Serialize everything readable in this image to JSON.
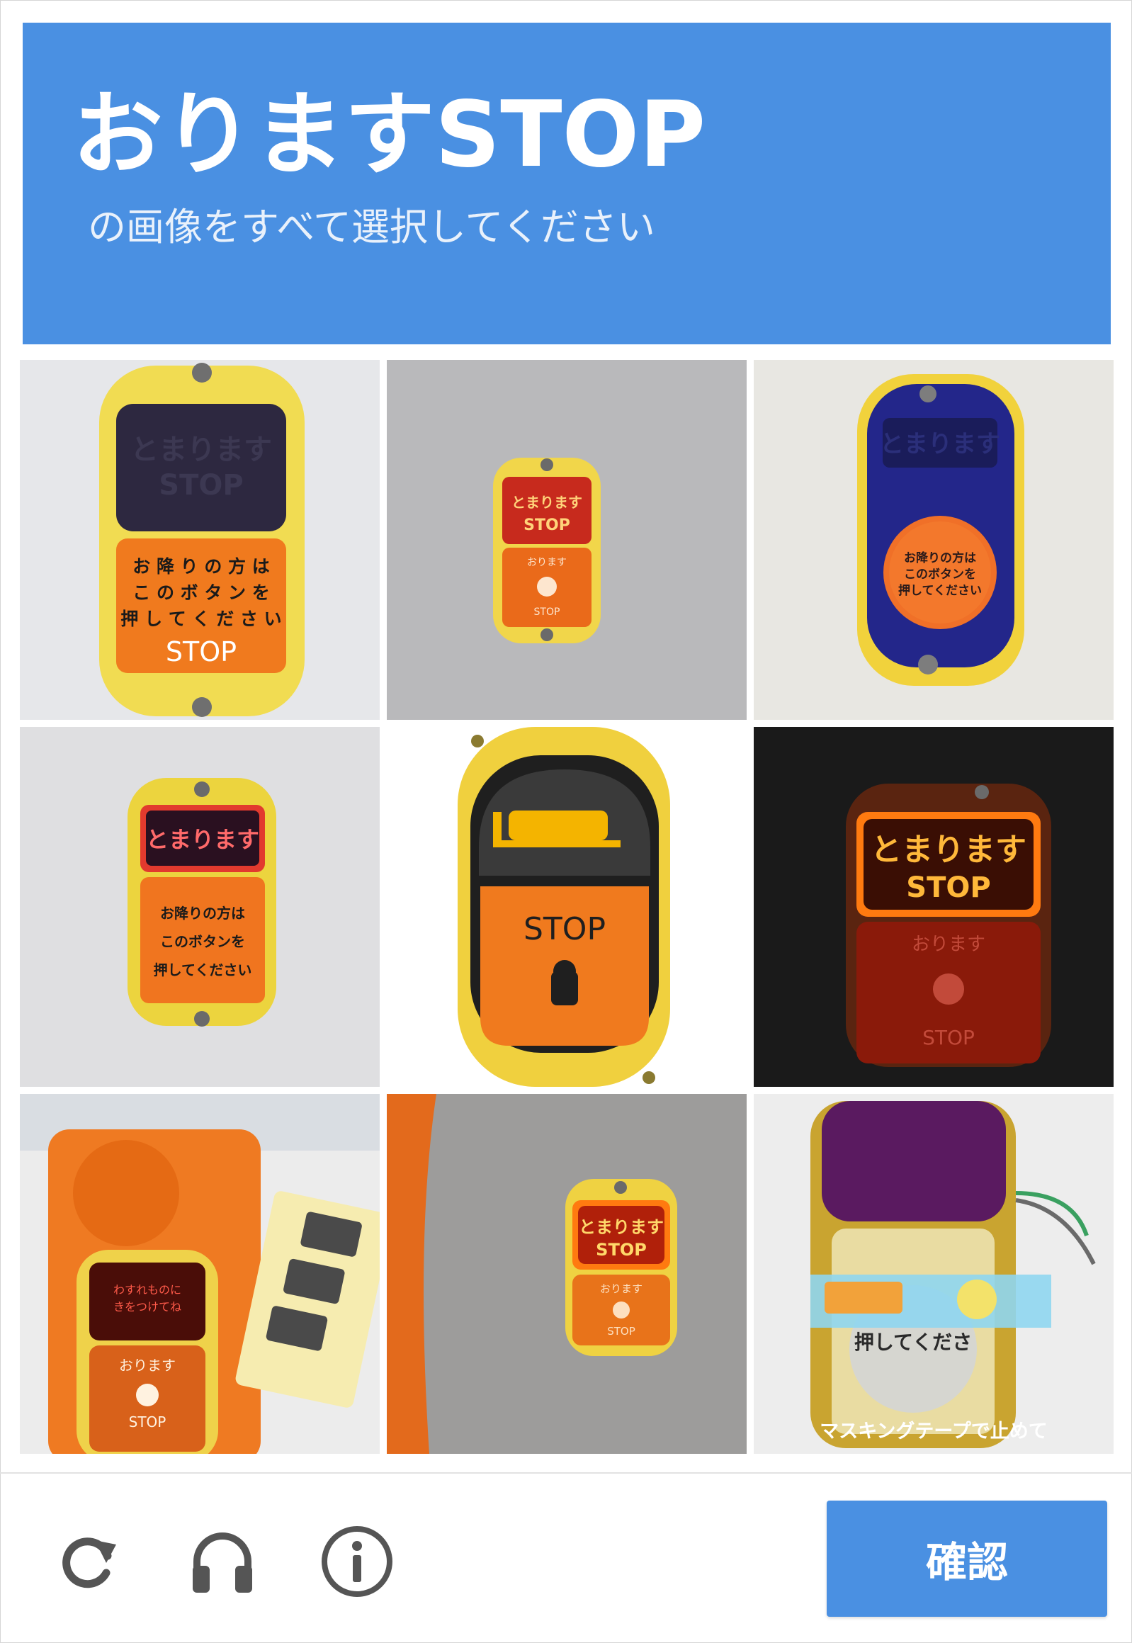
{
  "header": {
    "title": "おりますSTOP",
    "subtitle": "の画像をすべて選択してください"
  },
  "tiles": [
    {
      "lines": [
        "お 降 り の 方 は",
        "こ の ボ タ ン を",
        "押 し て く だ さ い",
        "STOP"
      ],
      "display": "とまります STOP"
    },
    {
      "display1": "とまります",
      "display2": "STOP",
      "lower1": "おります",
      "lower2": "STOP"
    },
    {
      "display": "とまります",
      "lines": [
        "お降りの方は",
        "このボタンを",
        "押してください"
      ]
    },
    {
      "display": "とまります",
      "lines": [
        "お降りの方は",
        "このボタンを",
        "押してください"
      ]
    },
    {
      "label": "STOP"
    },
    {
      "display1": "とまります",
      "display2": "STOP",
      "lower1": "おります",
      "lower2": "STOP"
    },
    {
      "display1": "わすれものに",
      "display2": "きをつけてね",
      "lower1": "おります",
      "lower2": "STOP"
    },
    {
      "display1": "とまります",
      "display2": "STOP",
      "lower1": "おります",
      "lower2": "STOP"
    },
    {
      "inner": "押してくださ",
      "caption": "マスキングテープで止めて"
    }
  ],
  "footer": {
    "verify_label": "確認",
    "icons": [
      "reload-icon",
      "headphones-icon",
      "info-icon"
    ]
  },
  "colors": {
    "accent": "#4a90e2",
    "button_yellow": "#f2d23a",
    "button_orange": "#f07a1e"
  }
}
